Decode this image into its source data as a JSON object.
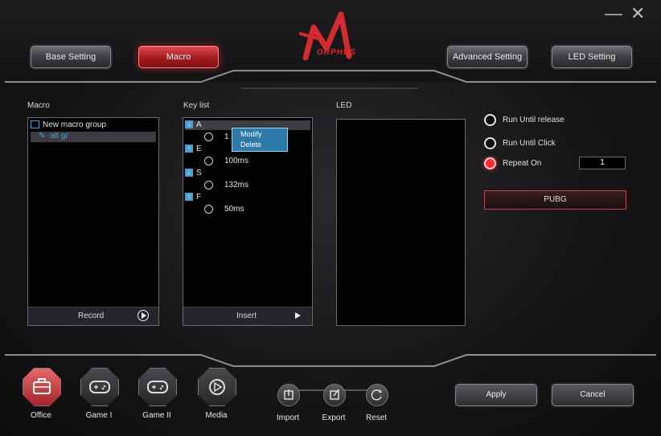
{
  "window": {
    "minimize_glyph": "—",
    "close_glyph": "✕"
  },
  "logo": {
    "text": "ORPHUS",
    "icon": "m-logo-icon"
  },
  "header_tabs": [
    {
      "label": "Base Setting",
      "active": false
    },
    {
      "label": "Macro",
      "active": true
    },
    {
      "label": "Advanced Setting",
      "active": false
    },
    {
      "label": "LED Setting",
      "active": false
    }
  ],
  "macro_panel": {
    "label": "Macro",
    "group_name": "New macro group",
    "selected_item": "alt gr",
    "footer_label": "Record",
    "footer_icon": "play-circle-icon"
  },
  "keylist_panel": {
    "label": "Key list",
    "rows": [
      {
        "kind": "key",
        "dir": "down",
        "text": "A"
      },
      {
        "kind": "delay",
        "text": "1"
      },
      {
        "kind": "key",
        "dir": "up",
        "text": "E"
      },
      {
        "kind": "delay",
        "text": "100ms"
      },
      {
        "kind": "key",
        "dir": "down",
        "text": "S"
      },
      {
        "kind": "delay",
        "text": "132ms"
      },
      {
        "kind": "key",
        "dir": "up",
        "text": "F"
      },
      {
        "kind": "delay",
        "text": "50ms"
      }
    ],
    "context_menu": [
      "Modify",
      "Delete"
    ],
    "footer_label": "Insert",
    "footer_icon": "play-arrow-icon"
  },
  "led_panel": {
    "label": "LED"
  },
  "options": {
    "run_until_release": "Run Until release",
    "run_until_click": "Run Until Click",
    "repeat_on": "Repeat On",
    "repeat_count": "1",
    "selected": "repeat_on",
    "profile_button": "PUBG"
  },
  "profiles": [
    {
      "label": "Office",
      "icon": "briefcase-icon",
      "active": true
    },
    {
      "label": "Game I",
      "icon": "gamepad-icon",
      "active": false
    },
    {
      "label": "Game II",
      "icon": "gamepad-icon",
      "active": false
    },
    {
      "label": "Media",
      "icon": "media-play-icon",
      "active": false
    }
  ],
  "file_actions": [
    {
      "label": "Import",
      "icon": "import-icon"
    },
    {
      "label": "Export",
      "icon": "export-icon"
    },
    {
      "label": "Reset",
      "icon": "reset-icon"
    }
  ],
  "footer_buttons": {
    "apply": "Apply",
    "cancel": "Cancel"
  },
  "colors": {
    "accent": "#d52b30",
    "selection": "#4aa1cf",
    "panel_bg": "#020203"
  }
}
